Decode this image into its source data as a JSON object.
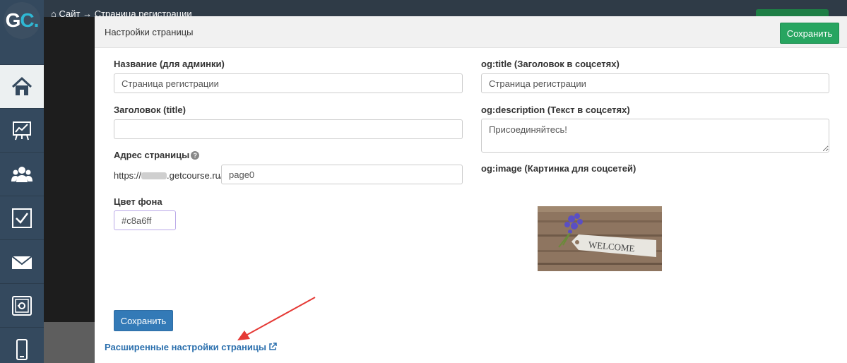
{
  "app": {
    "logo_text": "GC",
    "logo_dot": "."
  },
  "breadcrumb": {
    "site": "Сайт",
    "separator": "→",
    "page": "Страница регистрации"
  },
  "sidebar": {
    "items": [
      {
        "icon": "home-icon",
        "active": true
      },
      {
        "icon": "chart-icon",
        "active": false
      },
      {
        "icon": "users-icon",
        "active": false
      },
      {
        "icon": "checkbox-icon",
        "active": false
      },
      {
        "icon": "mail-icon",
        "active": false
      },
      {
        "icon": "safe-icon",
        "active": false
      },
      {
        "icon": "mobile-icon",
        "active": false
      }
    ]
  },
  "modal": {
    "title": "Настройки страницы",
    "save_top": "Сохранить",
    "fields": {
      "admin_name": {
        "label": "Название (для админки)",
        "value": "Страница регистрации"
      },
      "title": {
        "label": "Заголовок (title)",
        "value": ""
      },
      "address": {
        "label": "Адрес страницы",
        "prefix_start": "https://",
        "prefix_end": ".getcourse.ru/",
        "value": "page0"
      },
      "bg_color": {
        "label": "Цвет фона",
        "value": "#c8a6ff"
      },
      "og_title": {
        "label": "og:title (Заголовок в соцсетях)",
        "value": "Страница регистрации"
      },
      "og_description": {
        "label": "og:description (Текст в соцсетях)",
        "value": "Присоединяйтесь!"
      },
      "og_image": {
        "label": "og:image (Картинка для соцсетей)",
        "image_text": "WELCOME"
      }
    },
    "save_bottom": "Сохранить",
    "advanced_link": "Расширенные настройки страницы"
  },
  "colors": {
    "sidebar": "#34495e",
    "green_button": "#27a560",
    "blue_button": "#337ab7",
    "link": "#2a6fad",
    "arrow": "#e53935"
  }
}
